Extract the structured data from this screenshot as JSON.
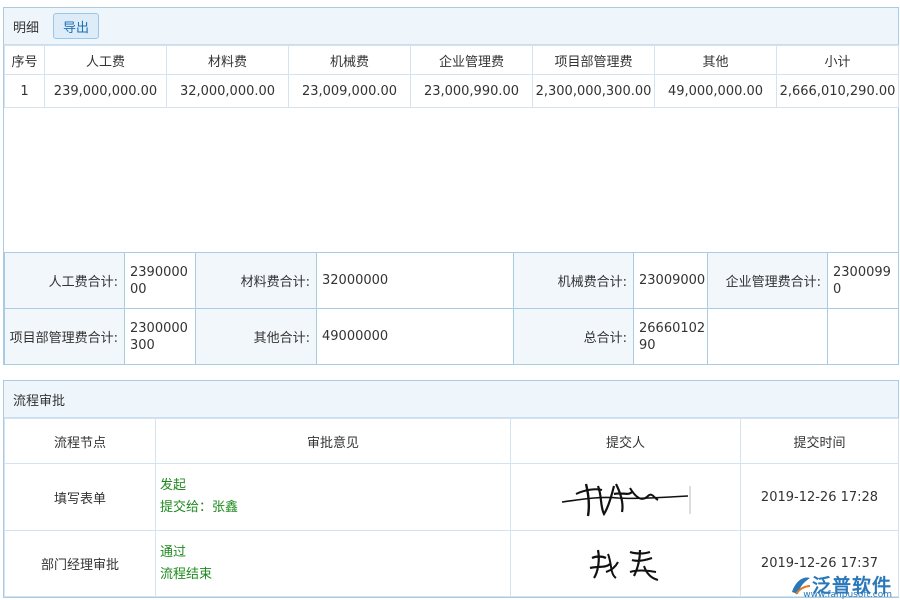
{
  "detail": {
    "title": "明细",
    "export_label": "导出",
    "columns": [
      "序号",
      "人工费",
      "材料费",
      "机械费",
      "企业管理费",
      "项目部管理费",
      "其他",
      "小计"
    ],
    "rows": [
      [
        "1",
        "239,000,000.00",
        "32,000,000.00",
        "23,009,000.00",
        "23,000,990.00",
        "2,300,000,300.00",
        "49,000,000.00",
        "2,666,010,290.00"
      ]
    ],
    "totals": {
      "labor_label": "人工费合计:",
      "labor_value": "239000000",
      "material_label": "材料费合计:",
      "material_value": "32000000",
      "machine_label": "机械费合计:",
      "machine_value": "23009000",
      "enterprise_label": "企业管理费合计:",
      "enterprise_value": "23000990",
      "project_label": "项目部管理费合计:",
      "project_value": "2300000300",
      "other_label": "其他合计:",
      "other_value": "49000000",
      "grand_label": "总合计:",
      "grand_value": "2666010290"
    }
  },
  "approval": {
    "title": "流程审批",
    "columns": [
      "流程节点",
      "审批意见",
      "提交人",
      "提交时间"
    ],
    "rows": [
      {
        "node": "填写表单",
        "action": "发起",
        "detail": "提交给：张鑫",
        "time": "2019-12-26 17:28"
      },
      {
        "node": "部门经理审批",
        "action": "通过",
        "detail": "流程结束",
        "time": "2019-12-26 17:37"
      }
    ]
  },
  "watermark": {
    "text": "泛普软件",
    "url": "www.fanpusoft.com"
  },
  "colors": {
    "border": "#a9cce3",
    "header_bg": "#eef5fb",
    "accent": "#1f6fb2",
    "opinion_green": "#1e8a1e"
  }
}
